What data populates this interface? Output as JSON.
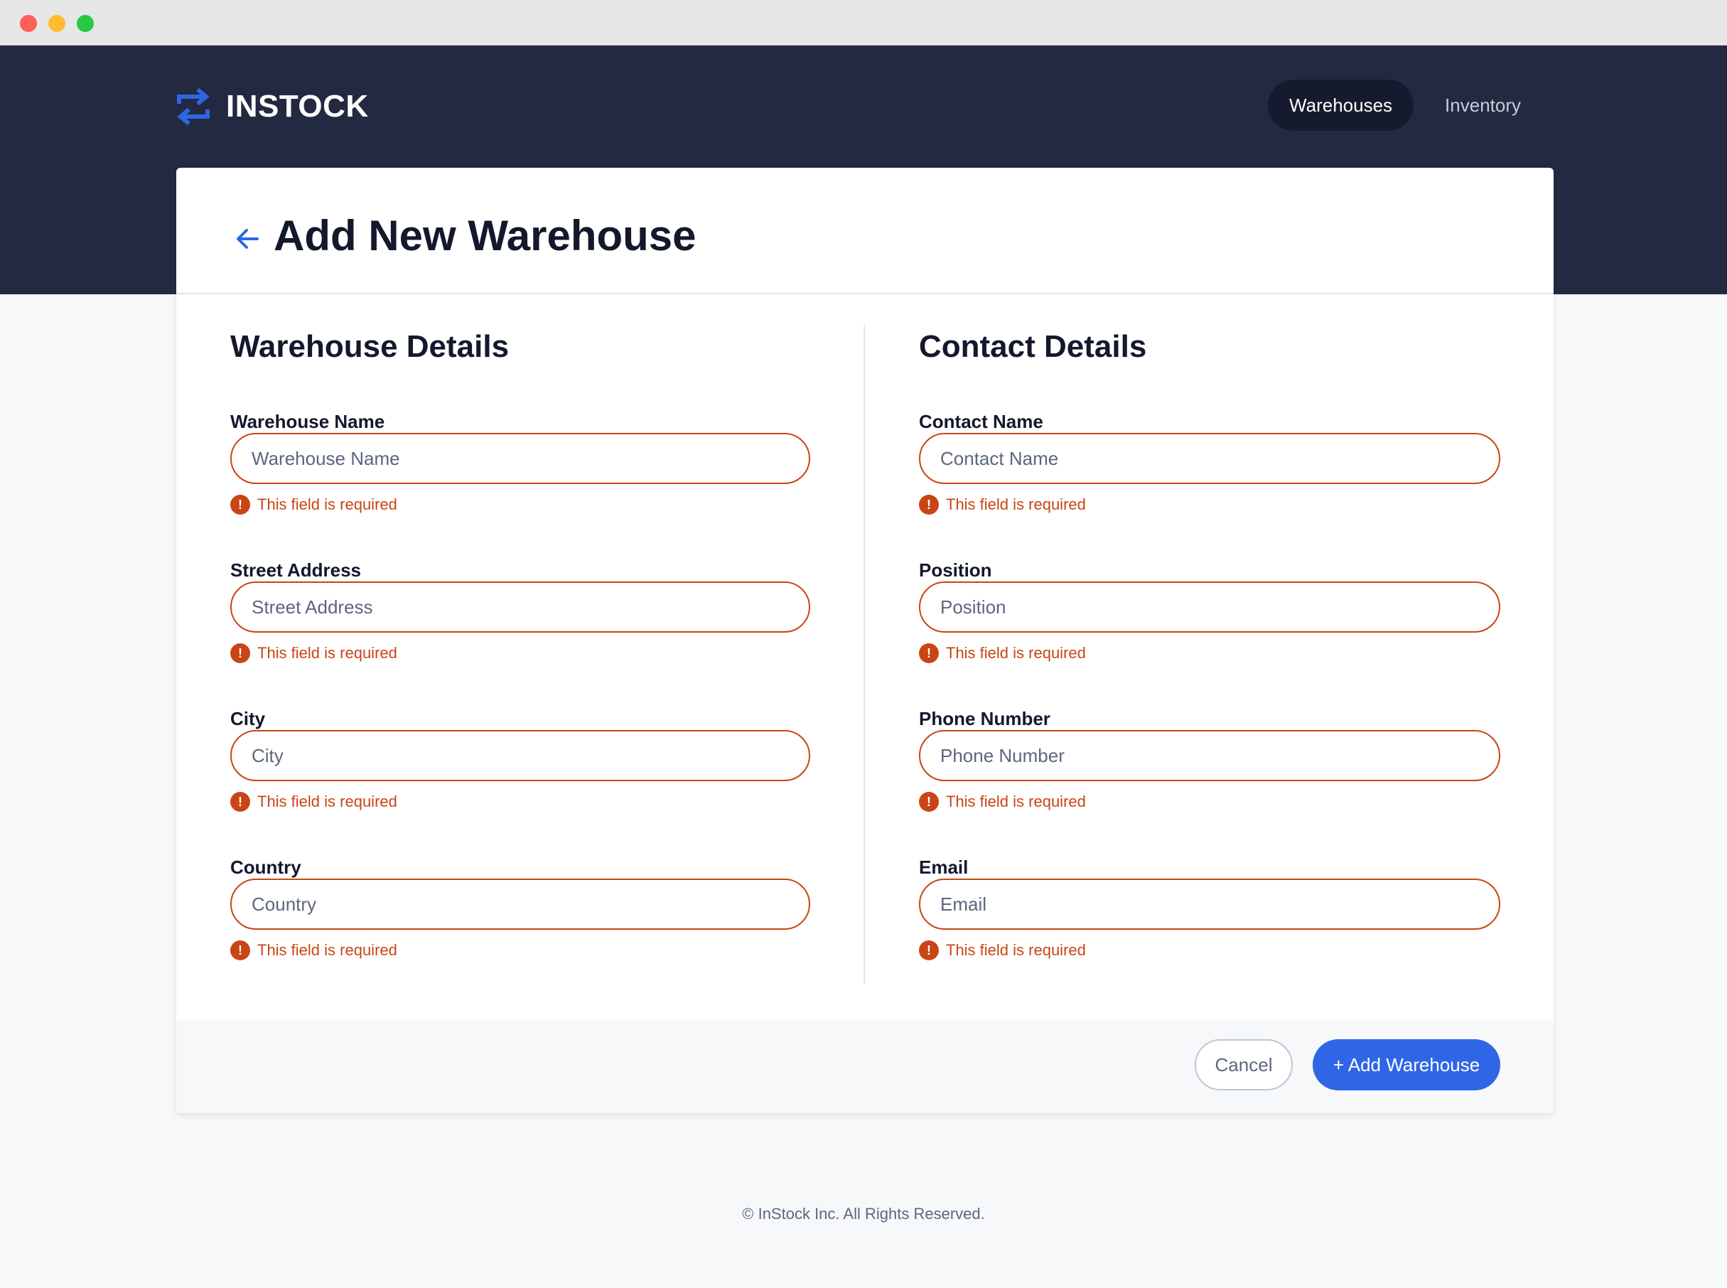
{
  "window": {
    "controls": [
      "close",
      "minimize",
      "maximize"
    ]
  },
  "brand": {
    "name": "INSTOCK",
    "icon": "swap-arrows-icon",
    "accent": "#2e66e5"
  },
  "nav": {
    "items": [
      {
        "label": "Warehouses",
        "active": true
      },
      {
        "label": "Inventory",
        "active": false
      }
    ]
  },
  "page": {
    "title": "Add New Warehouse",
    "back_icon": "arrow-left-icon"
  },
  "warehouse_section": {
    "title": "Warehouse Details",
    "fields": [
      {
        "label": "Warehouse Name",
        "placeholder": "Warehouse Name",
        "error": "This field is required"
      },
      {
        "label": "Street Address",
        "placeholder": "Street Address",
        "error": "This field is required"
      },
      {
        "label": "City",
        "placeholder": "City",
        "error": "This field is required"
      },
      {
        "label": "Country",
        "placeholder": "Country",
        "error": "This field is required"
      }
    ]
  },
  "contact_section": {
    "title": "Contact Details",
    "fields": [
      {
        "label": "Contact Name",
        "placeholder": "Contact Name",
        "error": "This field is required"
      },
      {
        "label": "Position",
        "placeholder": "Position",
        "error": "This field is required"
      },
      {
        "label": "Phone Number",
        "placeholder": "Phone Number",
        "error": "This field is required"
      },
      {
        "label": "Email",
        "placeholder": "Email",
        "error": "This field is required"
      }
    ]
  },
  "error_icon_glyph": "!",
  "actions": {
    "cancel_label": "Cancel",
    "submit_label": "+ Add Warehouse"
  },
  "footer": {
    "copyright": "© InStock Inc. All Rights Reserved."
  },
  "colors": {
    "header_bg": "#232940",
    "error": "#c94515",
    "primary": "#2e66e5"
  }
}
